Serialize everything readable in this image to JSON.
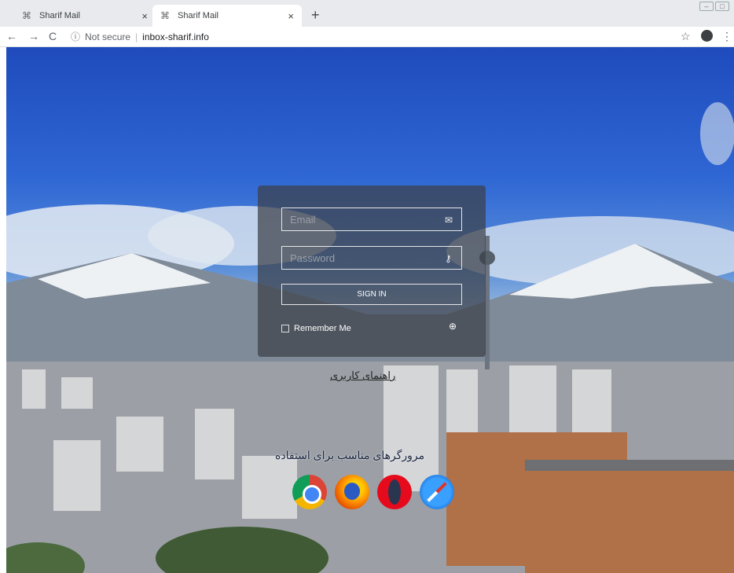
{
  "browser": {
    "tabs": [
      {
        "title": "Sharif Mail",
        "icon": "mail-icon"
      },
      {
        "title": "Sharif Mail",
        "icon": "mail-icon"
      }
    ],
    "security": "Not secure",
    "url": "inbox-sharif.info"
  },
  "login": {
    "email_placeholder": "Email",
    "password_placeholder": "Password",
    "signin_label": "SIGN IN",
    "remember_label": "Remember Me"
  },
  "guide_text": "راهنمای کاربری",
  "browsers_text": "مرورگرهای مناسب برای استفاده",
  "browser_icons": [
    "chrome",
    "firefox",
    "opera",
    "safari"
  ],
  "colors": {
    "panel": "#3c4048",
    "sky": "#2f67d4"
  }
}
